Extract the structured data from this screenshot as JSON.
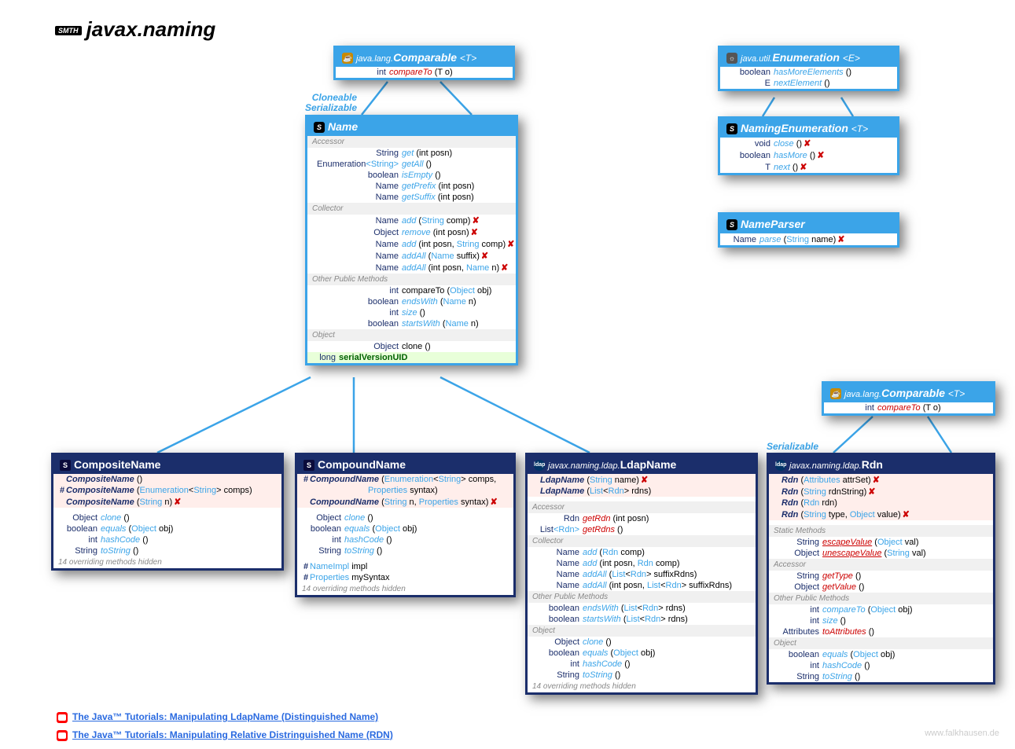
{
  "package": {
    "badge": "SMTH",
    "title": "javax.naming"
  },
  "anno": {
    "cloneable": "Cloneable",
    "serializable": "Serializable"
  },
  "comparable1": {
    "prefix": "java.lang.",
    "name": "Comparable",
    "tparam": "<T>",
    "row": {
      "ret": "int",
      "name": "compareTo",
      "params": "(T o)"
    }
  },
  "comparable2": {
    "prefix": "java.lang.",
    "name": "Comparable",
    "tparam": "<T>",
    "row": {
      "ret": "int",
      "name": "compareTo",
      "params": "(T o)"
    }
  },
  "enumeration": {
    "prefix": "java.util.",
    "name": "Enumeration",
    "tparam": "<E>",
    "rows": [
      {
        "ret": "boolean",
        "name": "hasMoreElements",
        "params": "()"
      },
      {
        "ret": "E",
        "name": "nextElement",
        "params": "()"
      }
    ]
  },
  "namingEnum": {
    "name": "NamingEnumeration",
    "tparam": "<T>",
    "rows": [
      {
        "ret": "void",
        "name": "close",
        "params": "()",
        "throws": true
      },
      {
        "ret": "boolean",
        "name": "hasMore",
        "params": "()",
        "throws": true
      },
      {
        "ret": "T",
        "name": "next",
        "params": "()",
        "throws": true
      }
    ]
  },
  "nameParser": {
    "name": "NameParser",
    "rows": [
      {
        "ret": "Name",
        "name": "parse",
        "params": "(String name)",
        "throws": true
      }
    ]
  },
  "name": {
    "title": "Name",
    "sections": [
      {
        "label": "Accessor",
        "rows": [
          {
            "ret": "String",
            "name": "get",
            "params": "(int posn)"
          },
          {
            "ret": "Enumeration<String>",
            "name": "getAll",
            "params": "()"
          },
          {
            "ret": "boolean",
            "name": "isEmpty",
            "params": "()"
          },
          {
            "ret": "Name",
            "name": "getPrefix",
            "params": "(int posn)"
          },
          {
            "ret": "Name",
            "name": "getSuffix",
            "params": "(int posn)"
          }
        ]
      },
      {
        "label": "Collector",
        "rows": [
          {
            "ret": "Name",
            "name": "add",
            "params": "(String comp)",
            "throws": true
          },
          {
            "ret": "Object",
            "name": "remove",
            "params": "(int posn)",
            "throws": true
          },
          {
            "ret": "Name",
            "name": "add",
            "params": "(int posn, String comp)",
            "throws": true
          },
          {
            "ret": "Name",
            "name": "addAll",
            "params": "(Name suffix)",
            "throws": true
          },
          {
            "ret": "Name",
            "name": "addAll",
            "params": "(int posn, Name n)",
            "throws": true
          }
        ]
      },
      {
        "label": "Other Public Methods",
        "rows": [
          {
            "ret": "int",
            "name": "compareTo",
            "params": "(Object obj)",
            "black": true
          },
          {
            "ret": "boolean",
            "name": "endsWith",
            "params": "(Name n)"
          },
          {
            "ret": "int",
            "name": "size",
            "params": "()"
          },
          {
            "ret": "boolean",
            "name": "startsWith",
            "params": "(Name n)"
          }
        ]
      },
      {
        "label": "Object",
        "rows": [
          {
            "ret": "Object",
            "name": "clone",
            "params": "()",
            "black": true
          }
        ]
      }
    ],
    "field": {
      "ret": "long",
      "name": "serialVersionUID"
    }
  },
  "compositeName": {
    "title": "CompositeName",
    "ctors": [
      {
        "vis": "",
        "name": "CompositeName",
        "params": "()"
      },
      {
        "vis": "#",
        "name": "CompositeName",
        "params": "(Enumeration<String> comps)"
      },
      {
        "vis": "",
        "name": "CompositeName",
        "params": "(String n)",
        "throws": true
      }
    ],
    "methods": [
      {
        "ret": "Object",
        "name": "clone",
        "params": "()"
      },
      {
        "ret": "boolean",
        "name": "equals",
        "params": "(Object obj)"
      },
      {
        "ret": "int",
        "name": "hashCode",
        "params": "()"
      },
      {
        "ret": "String",
        "name": "toString",
        "params": "()"
      }
    ],
    "note": "14 overriding methods hidden"
  },
  "compoundName": {
    "title": "CompoundName",
    "ctors": [
      {
        "vis": "#",
        "name": "CompoundName",
        "params": "(Enumeration<String> comps,",
        "params2": "Properties syntax)"
      },
      {
        "vis": "",
        "name": "CompoundName",
        "params": "(String n, Properties syntax)",
        "throws": true
      }
    ],
    "methods": [
      {
        "ret": "Object",
        "name": "clone",
        "params": "()"
      },
      {
        "ret": "boolean",
        "name": "equals",
        "params": "(Object obj)"
      },
      {
        "ret": "int",
        "name": "hashCode",
        "params": "()"
      },
      {
        "ret": "String",
        "name": "toString",
        "params": "()"
      }
    ],
    "fields": [
      {
        "vis": "#",
        "type": "NameImpl",
        "name": "impl"
      },
      {
        "vis": "#",
        "type": "Properties",
        "name": "mySyntax"
      }
    ],
    "note": "14 overriding methods hidden"
  },
  "ldapName": {
    "prefix": "javax.naming.ldap.",
    "title": "LdapName",
    "ctors": [
      {
        "name": "LdapName",
        "params": "(String name)",
        "throws": true
      },
      {
        "name": "LdapName",
        "params": "(List<Rdn> rdns)"
      }
    ],
    "sections": [
      {
        "label": "Accessor",
        "rows": [
          {
            "ret": "Rdn",
            "name": "getRdn",
            "params": "(int posn)",
            "red": true
          },
          {
            "ret": "List<Rdn>",
            "name": "getRdns",
            "params": "()",
            "red": true
          }
        ]
      },
      {
        "label": "Collector",
        "rows": [
          {
            "ret": "Name",
            "name": "add",
            "params": "(Rdn comp)"
          },
          {
            "ret": "Name",
            "name": "add",
            "params": "(int posn, Rdn comp)"
          },
          {
            "ret": "Name",
            "name": "addAll",
            "params": "(List<Rdn> suffixRdns)"
          },
          {
            "ret": "Name",
            "name": "addAll",
            "params": "(int posn, List<Rdn> suffixRdns)"
          }
        ]
      },
      {
        "label": "Other Public Methods",
        "rows": [
          {
            "ret": "boolean",
            "name": "endsWith",
            "params": "(List<Rdn> rdns)"
          },
          {
            "ret": "boolean",
            "name": "startsWith",
            "params": "(List<Rdn> rdns)"
          }
        ]
      },
      {
        "label": "Object",
        "rows": [
          {
            "ret": "Object",
            "name": "clone",
            "params": "()"
          },
          {
            "ret": "boolean",
            "name": "equals",
            "params": "(Object obj)"
          },
          {
            "ret": "int",
            "name": "hashCode",
            "params": "()"
          },
          {
            "ret": "String",
            "name": "toString",
            "params": "()"
          }
        ]
      }
    ],
    "note": "14 overriding methods hidden"
  },
  "rdn": {
    "prefix": "javax.naming.ldap.",
    "title": "Rdn",
    "ctors": [
      {
        "name": "Rdn",
        "params": "(Attributes attrSet)",
        "throws": true
      },
      {
        "name": "Rdn",
        "params": "(String rdnString)",
        "throws": true
      },
      {
        "name": "Rdn",
        "params": "(Rdn rdn)"
      },
      {
        "name": "Rdn",
        "params": "(String type, Object value)",
        "throws": true
      }
    ],
    "sections": [
      {
        "label": "Static Methods",
        "rows": [
          {
            "ret": "String",
            "name": "escapeValue",
            "params": "(Object val)",
            "static": true,
            "red": true
          },
          {
            "ret": "Object",
            "name": "unescapeValue",
            "params": "(String val)",
            "static": true,
            "red": true
          }
        ]
      },
      {
        "label": "Accessor",
        "rows": [
          {
            "ret": "String",
            "name": "getType",
            "params": "()",
            "red": true
          },
          {
            "ret": "Object",
            "name": "getValue",
            "params": "()",
            "red": true
          }
        ]
      },
      {
        "label": "Other Public Methods",
        "rows": [
          {
            "ret": "int",
            "name": "compareTo",
            "params": "(Object obj)"
          },
          {
            "ret": "int",
            "name": "size",
            "params": "()"
          },
          {
            "ret": "Attributes",
            "name": "toAttributes",
            "params": "()",
            "red": true
          }
        ]
      },
      {
        "label": "Object",
        "rows": [
          {
            "ret": "boolean",
            "name": "equals",
            "params": "(Object obj)"
          },
          {
            "ret": "int",
            "name": "hashCode",
            "params": "()"
          },
          {
            "ret": "String",
            "name": "toString",
            "params": "()"
          }
        ]
      }
    ]
  },
  "links": [
    "The Java™ Tutorials: Manipulating LdapName (Distinguished Name)",
    "The Java™ Tutorials: Manipulating Relative Distringuished Name (RDN)"
  ],
  "footer": "www.falkhausen.de"
}
